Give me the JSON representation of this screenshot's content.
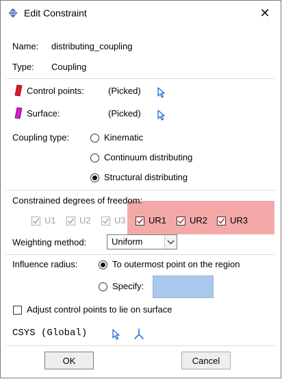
{
  "window": {
    "title": "Edit Constraint",
    "close_glyph": "✕"
  },
  "name_row": {
    "label": "Name:",
    "value": "distributing_coupling"
  },
  "type_row": {
    "label": "Type:",
    "value": "Coupling"
  },
  "control_points": {
    "label": "Control points:",
    "value": "(Picked)",
    "icon": "red-marker-icon",
    "pick_icon": "pick-arrow-icon"
  },
  "surface": {
    "label": "Surface:",
    "value": "(Picked)",
    "icon": "magenta-surface-icon",
    "pick_icon": "pick-arrow-icon"
  },
  "coupling_type": {
    "label": "Coupling type:",
    "options": [
      {
        "label": "Kinematic",
        "selected": false
      },
      {
        "label": "Continuum distributing",
        "selected": false
      },
      {
        "label": "Structural distributing",
        "selected": true
      }
    ]
  },
  "dof": {
    "label": "Constrained degrees of freedom:",
    "items": [
      {
        "label": "U1",
        "checked": true,
        "enabled": false
      },
      {
        "label": "U2",
        "checked": true,
        "enabled": false
      },
      {
        "label": "U3",
        "checked": true,
        "enabled": false
      },
      {
        "label": "UR1",
        "checked": true,
        "enabled": true
      },
      {
        "label": "UR2",
        "checked": true,
        "enabled": true
      },
      {
        "label": "UR3",
        "checked": true,
        "enabled": true
      }
    ]
  },
  "weighting": {
    "label": "Weighting method:",
    "value": "Uniform"
  },
  "influence": {
    "label": "Influence radius:",
    "options": [
      {
        "label": "To outermost point on the region",
        "selected": true
      },
      {
        "label": "Specify:",
        "selected": false
      }
    ],
    "specify_value": ""
  },
  "adjust": {
    "label": "Adjust control points to lie on surface",
    "checked": false
  },
  "csys": {
    "label": "CSYS (Global)"
  },
  "buttons": {
    "ok": "OK",
    "cancel": "Cancel"
  },
  "colors": {
    "highlight": "#f29a9a",
    "pick_arrow": "#2a73d8",
    "checkmark_active": "#cc2020",
    "checkmark_disabled": "#a0a0a0",
    "control_marker": "#e0142b",
    "surface_marker": "#cc22cc",
    "input_fill": "#a8c9eb"
  }
}
